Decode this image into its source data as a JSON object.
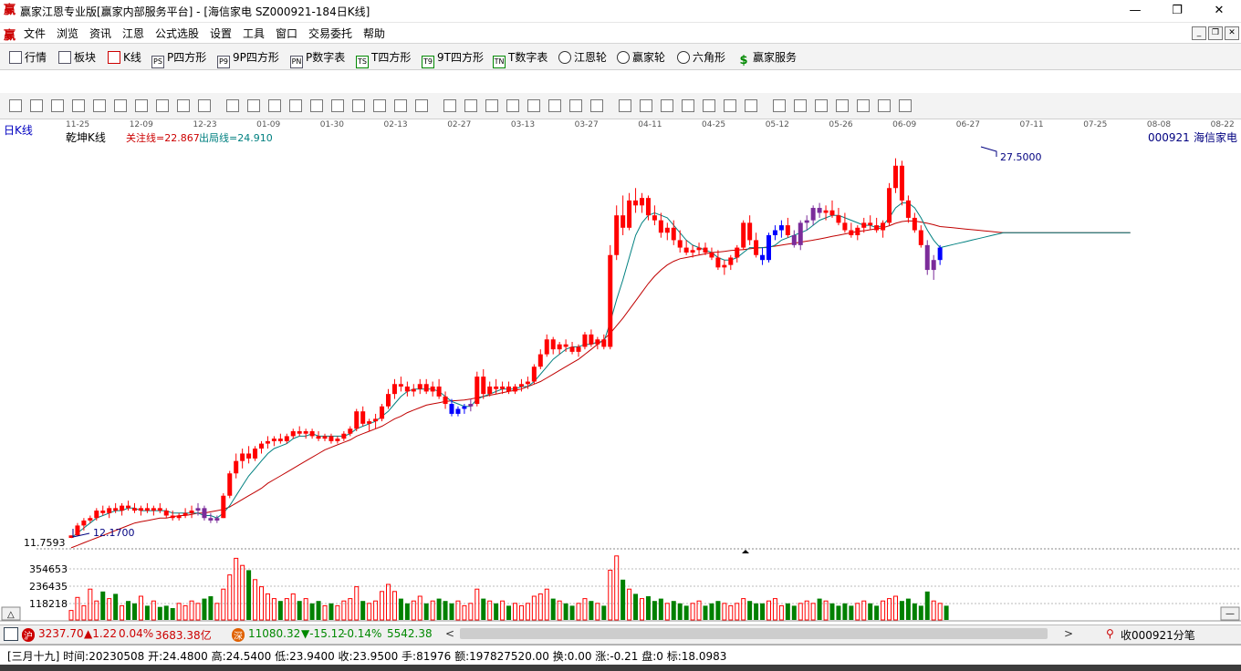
{
  "window": {
    "title": "赢家江恩专业版[赢家内部服务平台] - [海信家电  SZ000921-184日K线]",
    "logo": "赢",
    "minimize": "—",
    "restore": "❐",
    "close": "✕"
  },
  "menu": {
    "logo": "赢",
    "items": [
      "文件",
      "浏览",
      "资讯",
      "江恩",
      "公式选股",
      "设置",
      "工具",
      "窗口",
      "交易委托",
      "帮助"
    ],
    "mdi": [
      "_",
      "❐",
      "✕"
    ]
  },
  "toolbar1": [
    {
      "label": "行情",
      "icon": "grid-icon"
    },
    {
      "label": "板块",
      "icon": "blocks-icon"
    },
    {
      "label": "K线",
      "icon": "kline-icon"
    },
    {
      "label": "P四方形",
      "icon": "ps-icon"
    },
    {
      "label": "9P四方形",
      "icon": "p9-icon"
    },
    {
      "label": "P数字表",
      "icon": "pn-icon"
    },
    {
      "label": "T四方形",
      "icon": "ts-icon"
    },
    {
      "label": "9T四方形",
      "icon": "t9-icon"
    },
    {
      "label": "T数字表",
      "icon": "tn-icon"
    },
    {
      "label": "江恩轮",
      "icon": "gann-wheel-icon"
    },
    {
      "label": "赢家轮",
      "icon": "winner-wheel-icon"
    },
    {
      "label": "六角形",
      "icon": "hexagon-icon"
    },
    {
      "label": "赢家服务",
      "icon": "dollar-icon"
    }
  ],
  "toolbar1_icon_text": {
    "ps": "PS",
    "p9": "P9",
    "pn": "PN",
    "ts": "TS",
    "t9": "T9",
    "tn": "TN"
  },
  "chart": {
    "period_label": "日K线",
    "indicator_name": "乾坤K线",
    "focus_line": "关注线=22.867",
    "exit_line": "出局线=24.910",
    "stock_code": "000921",
    "stock_name": "海信家电",
    "high_label": "27.5000",
    "low_label": "12.1700",
    "price_floor": "11.7593",
    "date_ticks": [
      "11-25",
      "12-09",
      "12-23",
      "01-09",
      "01-30",
      "02-13",
      "02-27",
      "03-13",
      "03-27",
      "04-11",
      "04-25",
      "05-12",
      "05-26",
      "06-09",
      "06-27",
      "07-11",
      "07-25",
      "08-08",
      "08-22"
    ],
    "vol_ticks": [
      "354653",
      "236435",
      "118218"
    ],
    "colors": {
      "up": "#ff0000",
      "down": "#008000",
      "blue": "#0000ff",
      "purple": "#7b2c9a",
      "ma_fast": "#008080",
      "ma_slow": "#c00000"
    }
  },
  "chart_data": {
    "type": "candlestick",
    "ylim": [
      11.7593,
      28
    ],
    "candles": [
      [
        12.2,
        12.3,
        12.2,
        12.3
      ],
      [
        12.3,
        12.8,
        12.3,
        12.7
      ],
      [
        12.7,
        13.0,
        12.5,
        12.9
      ],
      [
        12.9,
        13.1,
        12.8,
        13.0
      ],
      [
        13.0,
        13.4,
        12.9,
        13.3
      ],
      [
        13.3,
        13.5,
        13.1,
        13.2
      ],
      [
        13.2,
        13.5,
        13.0,
        13.4
      ],
      [
        13.4,
        13.6,
        13.2,
        13.3
      ],
      [
        13.3,
        13.6,
        13.1,
        13.5
      ],
      [
        13.5,
        13.7,
        13.3,
        13.4
      ],
      [
        13.4,
        13.6,
        13.2,
        13.3
      ],
      [
        13.3,
        13.5,
        13.1,
        13.4
      ],
      [
        13.4,
        13.6,
        13.2,
        13.3
      ],
      [
        13.3,
        13.5,
        13.1,
        13.4
      ],
      [
        13.4,
        13.6,
        13.2,
        13.3
      ],
      [
        13.3,
        13.4,
        13.0,
        13.1
      ],
      [
        13.1,
        13.3,
        12.9,
        13.0
      ],
      [
        13.0,
        13.2,
        12.9,
        13.1
      ],
      [
        13.1,
        13.4,
        13.0,
        13.2
      ],
      [
        13.2,
        13.5,
        13.0,
        13.3
      ],
      [
        13.3,
        13.6,
        13.1,
        13.4
      ],
      [
        13.4,
        13.5,
        12.9,
        13.0
      ],
      [
        13.0,
        13.2,
        12.8,
        12.9
      ],
      [
        12.9,
        13.1,
        12.8,
        13.0
      ],
      [
        13.0,
        14.0,
        13.0,
        13.9
      ],
      [
        13.9,
        14.9,
        13.8,
        14.8
      ],
      [
        14.8,
        15.6,
        14.6,
        15.3
      ],
      [
        15.3,
        15.8,
        15.0,
        15.6
      ],
      [
        15.6,
        15.9,
        15.2,
        15.4
      ],
      [
        15.4,
        15.9,
        15.3,
        15.8
      ],
      [
        15.8,
        16.1,
        15.6,
        16.0
      ],
      [
        16.0,
        16.3,
        15.8,
        16.1
      ],
      [
        16.1,
        16.3,
        15.9,
        16.2
      ],
      [
        16.2,
        16.4,
        16.0,
        16.1
      ],
      [
        16.1,
        16.4,
        16.0,
        16.3
      ],
      [
        16.3,
        16.6,
        16.2,
        16.5
      ],
      [
        16.5,
        16.7,
        16.3,
        16.4
      ],
      [
        16.4,
        16.6,
        16.2,
        16.5
      ],
      [
        16.5,
        16.6,
        16.2,
        16.3
      ],
      [
        16.3,
        16.5,
        16.1,
        16.2
      ],
      [
        16.2,
        16.4,
        16.1,
        16.3
      ],
      [
        16.3,
        16.4,
        16.0,
        16.1
      ],
      [
        16.1,
        16.3,
        16.0,
        16.2
      ],
      [
        16.2,
        16.5,
        16.1,
        16.4
      ],
      [
        16.4,
        16.7,
        16.3,
        16.6
      ],
      [
        16.6,
        17.4,
        16.5,
        17.3
      ],
      [
        17.3,
        17.5,
        16.7,
        16.8
      ],
      [
        16.8,
        17.0,
        16.5,
        16.9
      ],
      [
        16.9,
        17.2,
        16.6,
        17.0
      ],
      [
        17.0,
        17.6,
        16.9,
        17.5
      ],
      [
        17.5,
        18.2,
        17.4,
        18.0
      ],
      [
        18.0,
        18.6,
        17.8,
        18.4
      ],
      [
        18.4,
        18.7,
        18.1,
        18.3
      ],
      [
        18.3,
        18.5,
        17.9,
        18.1
      ],
      [
        18.1,
        18.4,
        17.9,
        18.2
      ],
      [
        18.2,
        18.6,
        18.0,
        18.4
      ],
      [
        18.4,
        18.6,
        18.0,
        18.1
      ],
      [
        18.1,
        18.5,
        17.9,
        18.3
      ],
      [
        18.3,
        18.6,
        17.8,
        17.9
      ],
      [
        17.9,
        18.1,
        17.4,
        17.6
      ],
      [
        17.6,
        17.8,
        17.1,
        17.2
      ],
      [
        17.2,
        17.5,
        17.1,
        17.4
      ],
      [
        17.4,
        17.6,
        17.2,
        17.5
      ],
      [
        17.5,
        17.8,
        17.3,
        17.6
      ],
      [
        17.6,
        18.9,
        17.5,
        18.7
      ],
      [
        18.7,
        19.0,
        17.8,
        18.0
      ],
      [
        18.0,
        18.5,
        17.9,
        18.3
      ],
      [
        18.3,
        18.6,
        18.0,
        18.2
      ],
      [
        18.2,
        18.5,
        18.0,
        18.3
      ],
      [
        18.3,
        18.5,
        18.0,
        18.1
      ],
      [
        18.1,
        18.4,
        18.0,
        18.3
      ],
      [
        18.3,
        18.6,
        18.1,
        18.4
      ],
      [
        18.4,
        18.7,
        18.2,
        18.5
      ],
      [
        18.5,
        19.2,
        18.4,
        19.1
      ],
      [
        19.1,
        19.8,
        19.0,
        19.6
      ],
      [
        19.6,
        20.4,
        19.5,
        20.2
      ],
      [
        20.2,
        20.3,
        19.6,
        19.8
      ],
      [
        19.8,
        20.1,
        19.6,
        20.0
      ],
      [
        20.0,
        20.2,
        19.7,
        19.9
      ],
      [
        19.9,
        20.1,
        19.6,
        19.7
      ],
      [
        19.7,
        20.0,
        19.5,
        19.9
      ],
      [
        19.9,
        20.5,
        19.8,
        20.4
      ],
      [
        20.4,
        20.6,
        19.9,
        20.0
      ],
      [
        20.0,
        20.3,
        19.8,
        20.2
      ],
      [
        20.2,
        20.4,
        19.8,
        19.9
      ],
      [
        19.9,
        24.0,
        19.8,
        23.6
      ],
      [
        23.6,
        25.6,
        23.4,
        25.2
      ],
      [
        25.2,
        26.0,
        24.4,
        24.7
      ],
      [
        24.7,
        26.1,
        24.6,
        25.8
      ],
      [
        25.8,
        26.3,
        25.3,
        25.6
      ],
      [
        25.6,
        26.1,
        25.3,
        25.9
      ],
      [
        25.9,
        26.0,
        25.0,
        25.2
      ],
      [
        25.2,
        25.6,
        24.8,
        25.0
      ],
      [
        25.0,
        25.3,
        24.3,
        24.5
      ],
      [
        24.5,
        24.9,
        24.2,
        24.7
      ],
      [
        24.7,
        25.0,
        24.0,
        24.2
      ],
      [
        24.2,
        24.6,
        23.7,
        23.9
      ],
      [
        23.9,
        24.2,
        23.6,
        23.7
      ],
      [
        23.7,
        24.0,
        23.5,
        23.8
      ],
      [
        23.8,
        24.1,
        23.6,
        23.9
      ],
      [
        23.9,
        24.1,
        23.6,
        23.7
      ],
      [
        23.7,
        23.9,
        23.4,
        23.5
      ],
      [
        23.5,
        23.8,
        23.0,
        23.1
      ],
      [
        23.1,
        23.4,
        22.8,
        23.2
      ],
      [
        23.2,
        23.6,
        23.0,
        23.5
      ],
      [
        23.5,
        24.0,
        23.3,
        23.9
      ],
      [
        23.9,
        25.0,
        23.8,
        24.9
      ],
      [
        24.9,
        25.2,
        24.0,
        24.2
      ],
      [
        24.2,
        24.5,
        23.5,
        23.6
      ],
      [
        23.6,
        23.9,
        23.2,
        23.4
      ],
      [
        23.4,
        24.5,
        23.3,
        24.4
      ],
      [
        24.4,
        24.8,
        24.2,
        24.6
      ],
      [
        24.6,
        25.0,
        24.3,
        24.8
      ],
      [
        24.8,
        25.1,
        24.3,
        24.4
      ],
      [
        24.4,
        24.6,
        23.9,
        24.0
      ],
      [
        24.0,
        25.0,
        23.8,
        24.9
      ],
      [
        24.9,
        25.2,
        24.6,
        25.0
      ],
      [
        25.0,
        25.6,
        24.8,
        25.5
      ],
      [
        25.5,
        25.7,
        25.1,
        25.3
      ],
      [
        25.3,
        25.6,
        25.0,
        25.4
      ],
      [
        25.4,
        25.8,
        25.1,
        25.2
      ],
      [
        25.2,
        25.5,
        24.8,
        24.9
      ],
      [
        24.9,
        25.3,
        24.5,
        24.6
      ],
      [
        24.6,
        24.9,
        24.3,
        24.4
      ],
      [
        24.4,
        24.8,
        24.2,
        24.7
      ],
      [
        24.7,
        25.1,
        24.5,
        24.9
      ],
      [
        24.9,
        25.2,
        24.6,
        24.8
      ],
      [
        24.8,
        25.1,
        24.5,
        24.6
      ],
      [
        24.6,
        25.0,
        24.3,
        24.9
      ],
      [
        24.9,
        26.5,
        24.8,
        26.3
      ],
      [
        26.3,
        27.5,
        26.1,
        27.2
      ],
      [
        27.2,
        27.4,
        25.6,
        25.8
      ],
      [
        25.8,
        26.0,
        24.9,
        25.1
      ],
      [
        25.1,
        25.3,
        24.5,
        24.6
      ],
      [
        24.6,
        24.8,
        23.9,
        24.0
      ],
      [
        24.0,
        24.2,
        22.8,
        23.0
      ],
      [
        23.0,
        23.6,
        22.6,
        23.4
      ],
      [
        23.4,
        24.0,
        23.2,
        23.9
      ]
    ],
    "colors_per_candle": "red=up, green/blue/purple per indicator regime",
    "ma_fast": [
      12.2,
      12.4,
      12.6,
      12.8,
      13.0,
      13.1,
      13.2,
      13.3,
      13.3,
      13.4,
      13.4,
      13.3,
      13.3,
      13.3,
      13.3,
      13.3,
      13.2,
      13.2,
      13.2,
      13.2,
      13.2,
      13.1,
      13.1,
      13.0,
      13.2,
      13.5,
      13.9,
      14.3,
      14.7,
      15.0,
      15.3,
      15.6,
      15.8,
      15.9,
      16.0,
      16.2,
      16.3,
      16.3,
      16.4,
      16.3,
      16.3,
      16.3,
      16.3,
      16.3,
      16.4,
      16.6,
      16.7,
      16.8,
      16.9,
      17.1,
      17.3,
      17.6,
      17.9,
      18.1,
      18.2,
      18.2,
      18.2,
      18.2,
      18.1,
      17.9,
      17.7,
      17.6,
      17.5,
      17.5,
      17.8,
      17.9,
      18.0,
      18.1,
      18.2,
      18.2,
      18.2,
      18.3,
      18.3,
      18.5,
      18.8,
      19.1,
      19.4,
      19.6,
      19.8,
      19.9,
      19.9,
      20.0,
      20.0,
      20.1,
      20.1,
      20.9,
      21.8,
      22.6,
      23.5,
      24.4,
      24.9,
      25.2,
      25.3,
      25.2,
      25.1,
      24.8,
      24.5,
      24.2,
      24.0,
      23.9,
      23.8,
      23.7,
      23.5,
      23.4,
      23.4,
      23.5,
      23.7,
      23.9,
      23.9,
      23.9,
      23.9,
      24.0,
      24.2,
      24.3,
      24.4,
      24.5,
      24.6,
      24.8,
      25.0,
      25.1,
      25.2,
      25.2,
      25.1,
      25.0,
      24.9,
      24.8,
      24.8,
      24.7,
      24.8,
      25.1,
      25.5,
      25.7,
      25.7,
      25.5,
      25.1,
      24.6,
      24.2,
      23.9
    ],
    "ma_slow": [
      11.8,
      11.9,
      12.0,
      12.1,
      12.2,
      12.3,
      12.4,
      12.5,
      12.6,
      12.7,
      12.8,
      12.85,
      12.9,
      12.95,
      13.0,
      13.0,
      13.05,
      13.1,
      13.1,
      13.15,
      13.2,
      13.2,
      13.25,
      13.3,
      13.35,
      13.45,
      13.6,
      13.75,
      13.9,
      14.05,
      14.2,
      14.4,
      14.55,
      14.7,
      14.85,
      15.0,
      15.15,
      15.3,
      15.45,
      15.6,
      15.75,
      15.85,
      15.95,
      16.05,
      16.15,
      16.3,
      16.4,
      16.5,
      16.6,
      16.7,
      16.85,
      17.0,
      17.1,
      17.25,
      17.35,
      17.45,
      17.55,
      17.6,
      17.65,
      17.7,
      17.72,
      17.74,
      17.76,
      17.8,
      17.85,
      17.9,
      17.95,
      18.0,
      18.05,
      18.1,
      18.15,
      18.2,
      18.3,
      18.4,
      18.5,
      18.65,
      18.8,
      18.95,
      19.1,
      19.25,
      19.4,
      19.6,
      19.8,
      20.0,
      20.2,
      20.45,
      20.75,
      21.05,
      21.4,
      21.75,
      22.1,
      22.45,
      22.75,
      23.0,
      23.2,
      23.35,
      23.45,
      23.5,
      23.55,
      23.6,
      23.65,
      23.7,
      23.72,
      23.75,
      23.78,
      23.8,
      23.82,
      23.85,
      23.88,
      23.9,
      23.93,
      23.96,
      24.0,
      24.04,
      24.08,
      24.12,
      24.16,
      24.2,
      24.25,
      24.3,
      24.35,
      24.4,
      24.45,
      24.5,
      24.55,
      24.58,
      24.62,
      24.66,
      24.7,
      24.78,
      24.88,
      24.95,
      24.98,
      24.97,
      24.93,
      24.88,
      24.82,
      24.75
    ],
    "volumes": [
      40,
      95,
      60,
      130,
      80,
      120,
      90,
      110,
      60,
      80,
      70,
      100,
      60,
      80,
      55,
      60,
      50,
      70,
      60,
      80,
      70,
      90,
      100,
      70,
      130,
      190,
      260,
      230,
      210,
      170,
      140,
      110,
      90,
      80,
      90,
      110,
      80,
      90,
      70,
      80,
      60,
      70,
      60,
      80,
      90,
      140,
      80,
      70,
      80,
      120,
      150,
      120,
      90,
      70,
      80,
      100,
      70,
      80,
      90,
      80,
      70,
      80,
      60,
      70,
      130,
      90,
      80,
      70,
      80,
      60,
      70,
      60,
      70,
      100,
      110,
      130,
      90,
      80,
      70,
      60,
      70,
      90,
      80,
      70,
      60,
      210,
      270,
      170,
      130,
      110,
      90,
      100,
      80,
      90,
      70,
      80,
      70,
      60,
      70,
      80,
      60,
      70,
      80,
      70,
      60,
      70,
      90,
      80,
      70,
      70,
      80,
      90,
      60,
      70,
      60,
      70,
      80,
      70,
      90,
      80,
      70,
      60,
      70,
      60,
      70,
      80,
      70,
      60,
      80,
      90,
      100,
      80,
      90,
      70,
      60,
      120,
      80,
      70,
      60
    ],
    "vol_up_flags": [
      1,
      1,
      1,
      1,
      1,
      0,
      1,
      0,
      1,
      0,
      0,
      1,
      0,
      1,
      0,
      0,
      0,
      1,
      1,
      1,
      1,
      0,
      0,
      1,
      1,
      1,
      1,
      1,
      0,
      1,
      1,
      1,
      1,
      0,
      1,
      1,
      0,
      1,
      0,
      0,
      1,
      0,
      1,
      1,
      1,
      1,
      0,
      1,
      1,
      1,
      1,
      1,
      0,
      0,
      1,
      1,
      0,
      1,
      0,
      0,
      0,
      1,
      1,
      1,
      1,
      0,
      1,
      0,
      1,
      0,
      1,
      1,
      1,
      1,
      1,
      1,
      0,
      1,
      0,
      0,
      1,
      1,
      0,
      1,
      0,
      1,
      1,
      0,
      1,
      0,
      1,
      0,
      0,
      0,
      1,
      0,
      0,
      0,
      1,
      1,
      0,
      0,
      0,
      1,
      1,
      1,
      1,
      0,
      0,
      0,
      1,
      1,
      1,
      0,
      0,
      1,
      1,
      1,
      0,
      1,
      0,
      0,
      0,
      0,
      1,
      1,
      0,
      0,
      1,
      1,
      1,
      0,
      0,
      0,
      0,
      0,
      1,
      1
    ]
  },
  "scrollbar": {
    "sh_icon": "沪",
    "sh_index": "3237.70",
    "sh_change": "▲1.22",
    "sh_pct": "0.04%",
    "sh_amount": "3683.38亿",
    "sz_icon": "深",
    "sz_index": "11080.32",
    "sz_change": "▼-15.12",
    "sz_pct": "-0.14%",
    "sz_amount": "5542.38",
    "left_arrow": "<",
    "right_arrow": ">",
    "tick_label": "收000921分笔"
  },
  "status": {
    "text": "[三月十九] 时间:20230508 开:24.4800 高:24.5400 低:23.9400 收:23.9500 手:81976 额:197827520.00 换:0.00 涨:-0.21 盘:0 标:18.0983"
  }
}
